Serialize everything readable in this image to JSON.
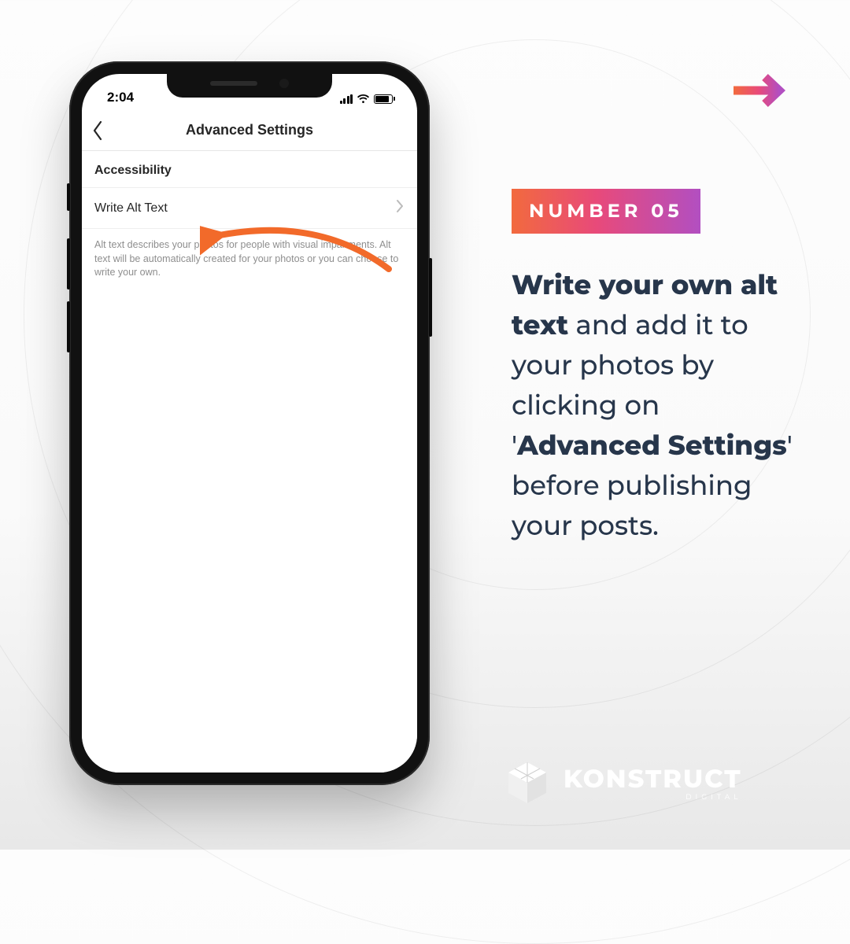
{
  "statusbar": {
    "time": "2:04"
  },
  "app": {
    "header_title": "Advanced Settings",
    "section_header": "Accessibility",
    "row_label": "Write Alt Text",
    "hint": "Alt text describes your photos for people with visual impairments. Alt text will be automatically created for your photos or you can choose to write your own."
  },
  "badge": "NUMBER 05",
  "tip": {
    "b1": "Write your own alt text",
    "m1": " and add it to your photos by clicking on '",
    "b2": "Advanced Settings",
    "m2": "' before publishing your posts."
  },
  "brand": {
    "name": "KONSTRUCT",
    "sub": "DIGITAL"
  }
}
